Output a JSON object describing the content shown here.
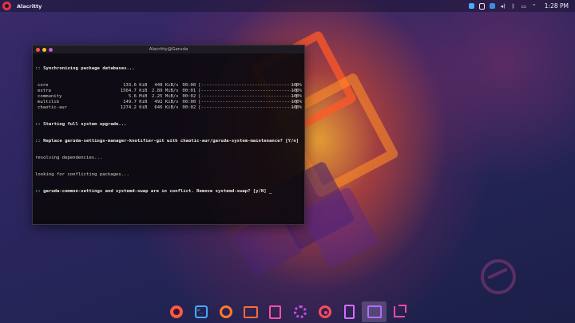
{
  "panel": {
    "app_title": "Alacritty",
    "clock": "1:28 PM",
    "tray_icons": [
      "dropbox-icon",
      "clipboard-icon",
      "update-icon",
      "audio-icon",
      "bluetooth-icon",
      "network-icon",
      "chevron-up-icon"
    ]
  },
  "terminal": {
    "title": "Alacritty@Garuda",
    "lines": {
      "sync": "Synchronizing package databases...",
      "upgrade": "Starting full system upgrade...",
      "replace": "Replace garuda-settings-manager-knotifier-git with chaotic-aur/garuda-system-maintenance? [Y/n]",
      "resolving": "resolving dependencies...",
      "looking": "looking for conflicting packages...",
      "conflict": "garuda-common-settings and systemd-swap are in conflict. Remove systemd-swap? [y/N] _"
    },
    "prefix": "::",
    "repos": [
      {
        "name": "core",
        "size": "133.6 KiB",
        "rate": "448 KiB/s",
        "time": "00:00",
        "bar": "[-----------------------------------]",
        "pct": "100%"
      },
      {
        "name": "extra",
        "size": "1564.7 KiB",
        "rate": "2.89 MiB/s",
        "time": "00:01",
        "bar": "[-----------------------------------]",
        "pct": "100%"
      },
      {
        "name": "community",
        "size": "5.6 MiB",
        "rate": "2.25 MiB/s",
        "time": "00:02",
        "bar": "[-----------------------------------]",
        "pct": "100%"
      },
      {
        "name": "multilib",
        "size": "149.7 KiB",
        "rate": "492 KiB/s",
        "time": "00:00",
        "bar": "[-----------------------------------]",
        "pct": "100%"
      },
      {
        "name": "chaotic-aur",
        "size": "1274.2 KiB",
        "rate": "646 KiB/s",
        "time": "00:02",
        "bar": "[-----------------------------------]",
        "pct": "100%"
      }
    ]
  },
  "dock": {
    "items": [
      {
        "name": "garuda-launcher-icon",
        "active": false
      },
      {
        "name": "terminal-icon",
        "active": false
      },
      {
        "name": "firedragon-browser-icon",
        "active": false
      },
      {
        "name": "file-manager-icon",
        "active": false
      },
      {
        "name": "text-editor-icon",
        "active": false
      },
      {
        "name": "settings-icon",
        "active": false
      },
      {
        "name": "music-player-icon",
        "active": false
      },
      {
        "name": "kde-connect-icon",
        "active": false
      },
      {
        "name": "garuda-welcome-icon",
        "active": true
      },
      {
        "name": "screenshot-tool-icon",
        "active": false
      }
    ]
  },
  "colors": {
    "accent": "#5fc8d8",
    "close": "#ff4d58",
    "minimize": "#ffbd2e",
    "maximize": "#c95cd7"
  }
}
